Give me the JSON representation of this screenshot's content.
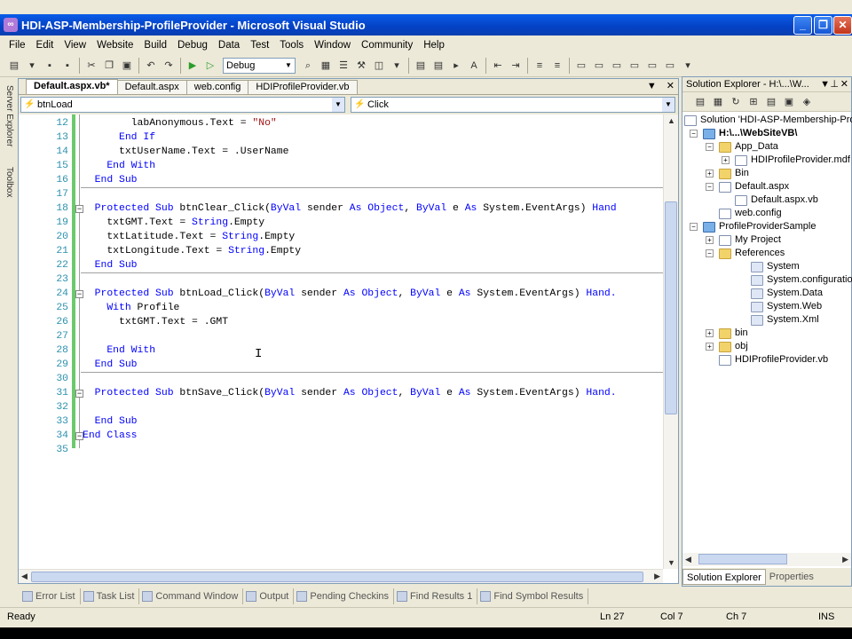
{
  "window": {
    "title": "HDI-ASP-Membership-ProfileProvider - Microsoft Visual Studio"
  },
  "menu": [
    "File",
    "Edit",
    "View",
    "Website",
    "Build",
    "Debug",
    "Data",
    "Test",
    "Tools",
    "Window",
    "Community",
    "Help"
  ],
  "toolbar": {
    "config": "Debug"
  },
  "left_strip": {
    "server_explorer": "Server Explorer",
    "toolbox": "Toolbox"
  },
  "doc_tabs": [
    "Default.aspx.vb*",
    "Default.aspx",
    "web.config",
    "HDIProfileProvider.vb"
  ],
  "nav": {
    "object": "btnLoad",
    "member": "Click"
  },
  "code_lines": [
    {
      "n": "12",
      "parts": [
        [
          "t",
          "        labAnonymous.Text = "
        ],
        [
          "s",
          "\"No\""
        ]
      ]
    },
    {
      "n": "13",
      "parts": [
        [
          "k",
          "      End If"
        ]
      ]
    },
    {
      "n": "14",
      "parts": [
        [
          "t",
          "      txtUserName.Text = .UserName"
        ]
      ]
    },
    {
      "n": "15",
      "parts": [
        [
          "k",
          "    End With"
        ]
      ]
    },
    {
      "n": "16",
      "parts": [
        [
          "k",
          "  End Sub"
        ]
      ]
    },
    {
      "n": "17",
      "parts": []
    },
    {
      "n": "18",
      "parts": [
        [
          "k",
          "  Protected Sub "
        ],
        [
          "t",
          "btnClear_Click("
        ],
        [
          "k",
          "ByVal "
        ],
        [
          "t",
          "sender "
        ],
        [
          "k",
          "As Object"
        ],
        [
          "t",
          ", "
        ],
        [
          "k",
          "ByVal "
        ],
        [
          "t",
          "e "
        ],
        [
          "k",
          "As "
        ],
        [
          "t",
          "System.EventArgs) "
        ],
        [
          "k",
          "Hand"
        ]
      ]
    },
    {
      "n": "19",
      "parts": [
        [
          "t",
          "    txtGMT.Text = "
        ],
        [
          "k",
          "String"
        ],
        [
          "t",
          ".Empty"
        ]
      ]
    },
    {
      "n": "20",
      "parts": [
        [
          "t",
          "    txtLatitude.Text = "
        ],
        [
          "k",
          "String"
        ],
        [
          "t",
          ".Empty"
        ]
      ]
    },
    {
      "n": "21",
      "parts": [
        [
          "t",
          "    txtLongitude.Text = "
        ],
        [
          "k",
          "String"
        ],
        [
          "t",
          ".Empty"
        ]
      ]
    },
    {
      "n": "22",
      "parts": [
        [
          "k",
          "  End Sub"
        ]
      ]
    },
    {
      "n": "23",
      "parts": []
    },
    {
      "n": "24",
      "parts": [
        [
          "k",
          "  Protected Sub "
        ],
        [
          "t",
          "btnLoad_Click("
        ],
        [
          "k",
          "ByVal "
        ],
        [
          "t",
          "sender "
        ],
        [
          "k",
          "As Object"
        ],
        [
          "t",
          ", "
        ],
        [
          "k",
          "ByVal "
        ],
        [
          "t",
          "e "
        ],
        [
          "k",
          "As "
        ],
        [
          "t",
          "System.EventArgs) "
        ],
        [
          "k",
          "Hand."
        ]
      ]
    },
    {
      "n": "25",
      "parts": [
        [
          "k",
          "    With "
        ],
        [
          "t",
          "Profile"
        ]
      ]
    },
    {
      "n": "26",
      "parts": [
        [
          "t",
          "      txtGMT.Text = .GMT"
        ]
      ]
    },
    {
      "n": "27",
      "parts": []
    },
    {
      "n": "28",
      "parts": [
        [
          "k",
          "    End With"
        ]
      ]
    },
    {
      "n": "29",
      "parts": [
        [
          "k",
          "  End Sub"
        ]
      ]
    },
    {
      "n": "30",
      "parts": []
    },
    {
      "n": "31",
      "parts": [
        [
          "k",
          "  Protected Sub "
        ],
        [
          "t",
          "btnSave_Click("
        ],
        [
          "k",
          "ByVal "
        ],
        [
          "t",
          "sender "
        ],
        [
          "k",
          "As Object"
        ],
        [
          "t",
          ", "
        ],
        [
          "k",
          "ByVal "
        ],
        [
          "t",
          "e "
        ],
        [
          "k",
          "As "
        ],
        [
          "t",
          "System.EventArgs) "
        ],
        [
          "k",
          "Hand."
        ]
      ]
    },
    {
      "n": "32",
      "parts": []
    },
    {
      "n": "33",
      "parts": [
        [
          "k",
          "  End Sub"
        ]
      ]
    },
    {
      "n": "34",
      "parts": [
        [
          "k",
          "End Class"
        ]
      ]
    },
    {
      "n": "35",
      "parts": []
    }
  ],
  "solution_explorer": {
    "title": "Solution Explorer - H:\\...\\W...",
    "nodes": [
      {
        "label": "Solution 'HDI-ASP-Membership-Profi",
        "icon": "file",
        "ex": ""
      },
      {
        "label": "H:\\...\\WebSiteVB\\",
        "icon": "proj",
        "ex": "−",
        "bold": true
      },
      {
        "label": "App_Data",
        "icon": "folder",
        "ex": "−"
      },
      {
        "label": "HDIProfileProvider.mdf",
        "icon": "file",
        "ex": "+"
      },
      {
        "label": "Bin",
        "icon": "folder",
        "ex": "+"
      },
      {
        "label": "Default.aspx",
        "icon": "file",
        "ex": "−"
      },
      {
        "label": "Default.aspx.vb",
        "icon": "file",
        "ex": ""
      },
      {
        "label": "web.config",
        "icon": "file",
        "ex": ""
      },
      {
        "label": "ProfileProviderSample",
        "icon": "proj",
        "ex": "−"
      },
      {
        "label": "My Project",
        "icon": "file",
        "ex": "+"
      },
      {
        "label": "References",
        "icon": "folder",
        "ex": "−"
      },
      {
        "label": "System",
        "icon": "ref",
        "ex": ""
      },
      {
        "label": "System.configuration",
        "icon": "ref",
        "ex": ""
      },
      {
        "label": "System.Data",
        "icon": "ref",
        "ex": ""
      },
      {
        "label": "System.Web",
        "icon": "ref",
        "ex": ""
      },
      {
        "label": "System.Xml",
        "icon": "ref",
        "ex": ""
      },
      {
        "label": "bin",
        "icon": "folder",
        "ex": "+"
      },
      {
        "label": "obj",
        "icon": "folder",
        "ex": "+"
      },
      {
        "label": "HDIProfileProvider.vb",
        "icon": "file",
        "ex": ""
      }
    ],
    "tabs": [
      "Solution Explorer",
      "Properties"
    ]
  },
  "bottom_tabs": [
    "Error List",
    "Task List",
    "Command Window",
    "Output",
    "Pending Checkins",
    "Find Results 1",
    "Find Symbol Results"
  ],
  "status": {
    "ready": "Ready",
    "ln": "Ln 27",
    "col": "Col 7",
    "ch": "Ch 7",
    "ins": "INS"
  }
}
